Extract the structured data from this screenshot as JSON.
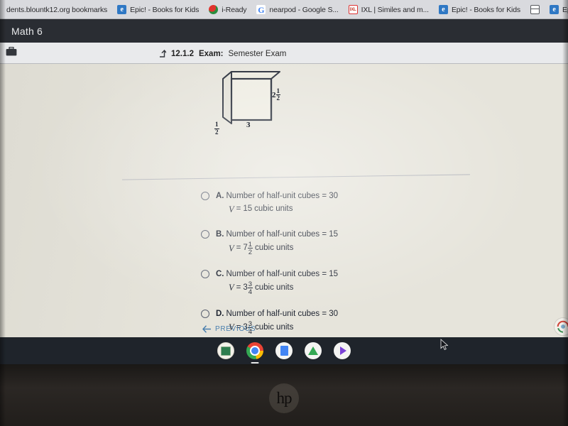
{
  "browser": {
    "bookmarks": [
      {
        "label": "dents.blountk12.org bookmarks",
        "icon": "folder-icon"
      },
      {
        "label": "Epic! - Books for Kids",
        "icon": "epic-icon"
      },
      {
        "label": "i-Ready",
        "icon": "iready-icon"
      },
      {
        "label": "nearpod - Google S...",
        "icon": "google-icon"
      },
      {
        "label": "IXL | Similes and m...",
        "icon": "ixl-icon"
      },
      {
        "label": "Epic! - Books for Kids",
        "icon": "epic-icon"
      },
      {
        "label": "",
        "icon": "grid-icon"
      },
      {
        "label": "Epic! - Books for Kids",
        "icon": "epic-icon"
      },
      {
        "label": "",
        "icon": "dash-icon"
      }
    ]
  },
  "app": {
    "title": "Math 6",
    "briefcase_icon": "briefcase-icon"
  },
  "exam_header": {
    "up_arrow_icon": "up-arrow-icon",
    "number": "12.1.2",
    "exam_word": "Exam:",
    "exam_title": "Semester Exam"
  },
  "figure": {
    "name": "rectangular-prism-diagram",
    "depth_whole": "",
    "depth_num": "1",
    "depth_den": "2",
    "width_label": "3",
    "height_whole": "2",
    "height_num": "1",
    "height_den": "2"
  },
  "choices": [
    {
      "letter": "A.",
      "line1": "Number of half-unit cubes = 30",
      "v_symbol": "V",
      "equals": "=",
      "whole": "15",
      "num": "",
      "den": "",
      "units": "cubic units",
      "selected": false
    },
    {
      "letter": "B.",
      "line1": "Number of half-unit cubes = 15",
      "v_symbol": "V",
      "equals": "=",
      "whole": "7",
      "num": "1",
      "den": "2",
      "units": "cubic units",
      "selected": false
    },
    {
      "letter": "C.",
      "line1": "Number of half-unit cubes = 15",
      "v_symbol": "V",
      "equals": "=",
      "whole": "3",
      "num": "3",
      "den": "4",
      "units": "cubic units",
      "selected": false
    },
    {
      "letter": "D.",
      "line1": "Number of half-unit cubes = 30",
      "v_symbol": "V",
      "equals": "=",
      "whole": "3",
      "num": "3",
      "den": "4",
      "units": "cubic units",
      "selected": false
    }
  ],
  "navigation": {
    "previous_label": "PREVIOUS",
    "previous_icon": "left-arrow-icon"
  },
  "help": {
    "icon": "help-bubble-icon"
  },
  "shelf": {
    "items": [
      {
        "name": "launcher-icon"
      },
      {
        "name": "chrome-icon"
      },
      {
        "name": "google-docs-icon"
      },
      {
        "name": "google-drive-icon"
      },
      {
        "name": "play-store-icon"
      }
    ]
  },
  "hardware": {
    "brand_logo": "hp"
  },
  "cursor": {
    "icon": "mouse-pointer-icon"
  },
  "colors": {
    "titlebar_bg": "#2a2d33",
    "page_bg": "#e6e4db",
    "shelf_bg": "#1f242b",
    "link_blue": "#4a7fae",
    "text_dark": "#1d2330"
  }
}
